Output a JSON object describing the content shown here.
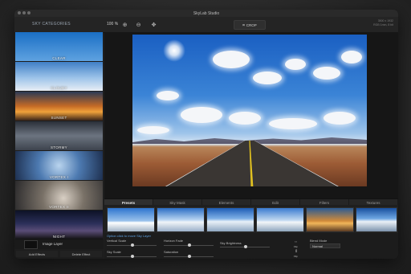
{
  "window": {
    "title": "SkyLab Studio"
  },
  "toolbar": {
    "categories_title": "SKY CATEGORIES",
    "zoom": "100 %",
    "crop_label": "CROP",
    "meta_line1": "3500 x 1932",
    "meta_line2": "RGB 1mm, 8 bit"
  },
  "categories": [
    {
      "label": "CLEAR"
    },
    {
      "label": "CLOUDY"
    },
    {
      "label": "SUNSET"
    },
    {
      "label": "STORMY"
    },
    {
      "label": "VORTEX I"
    },
    {
      "label": "VORTEX II"
    },
    {
      "label": "NIGHT"
    }
  ],
  "layers": {
    "name": "Image Layer",
    "add_effects": "Add Effects",
    "delete_effect": "Delete Effect"
  },
  "tabs": [
    {
      "label": "Presets",
      "active": true
    },
    {
      "label": "Sky Mask"
    },
    {
      "label": "Elements"
    },
    {
      "label": "Edit"
    },
    {
      "label": "Filters"
    },
    {
      "label": "Textures"
    }
  ],
  "controls": {
    "hint": "Option click to move Sky Layer",
    "vertical_scale": "Vertical Scale",
    "horizon_fade": "Horizon Fade",
    "sky_brightness": "Sky Brightness",
    "sky_scale": "Sky Scale",
    "saturation": "Saturation",
    "blend_mode": "Blend Mode",
    "blend_value": "Normal",
    "flip_h": "Flip",
    "flip_v": "Flip"
  },
  "colors": {
    "accent": "#5da0e0",
    "window_bg": "#1f1f1f"
  }
}
